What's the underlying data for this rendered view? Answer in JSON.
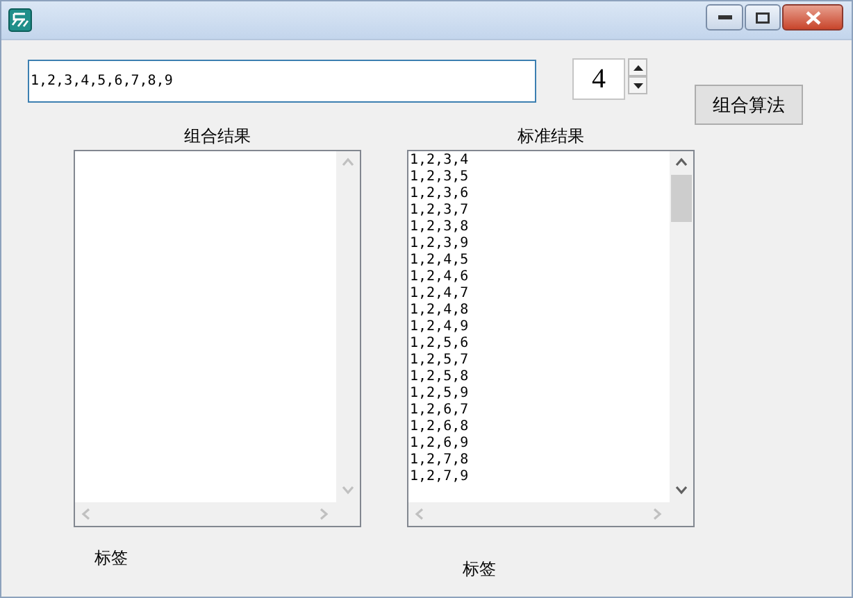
{
  "input": {
    "value": "1,2,3,4,5,6,7,8,9"
  },
  "spinner": {
    "value": "4"
  },
  "run_button": {
    "label": "组合算法"
  },
  "lists": [
    {
      "heading": "组合结果",
      "footer": "标签"
    },
    {
      "heading": "标准结果",
      "items": [
        "1,2,3,4",
        "1,2,3,5",
        "1,2,3,6",
        "1,2,3,7",
        "1,2,3,8",
        "1,2,3,9",
        "1,2,4,5",
        "1,2,4,6",
        "1,2,4,7",
        "1,2,4,8",
        "1,2,4,9",
        "1,2,5,6",
        "1,2,5,7",
        "1,2,5,8",
        "1,2,5,9",
        "1,2,6,7",
        "1,2,6,8",
        "1,2,6,9",
        "1,2,7,8",
        "1,2,7,9"
      ],
      "footer": "标签"
    }
  ]
}
